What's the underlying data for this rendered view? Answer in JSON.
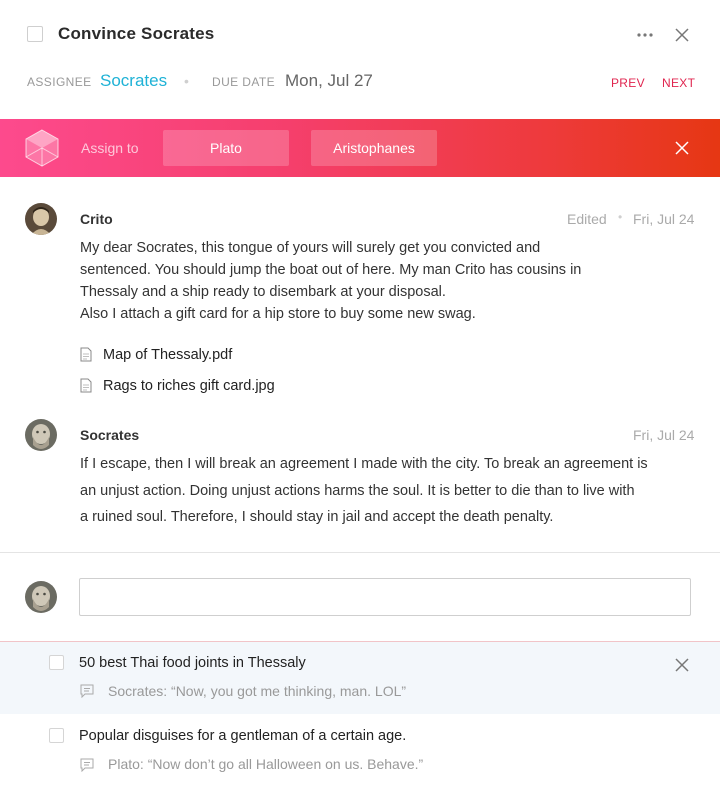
{
  "task": {
    "title": "Convince Socrates",
    "assignee_label": "ASSIGNEE",
    "assignee_value": "Socrates",
    "due_label": "DUE DATE",
    "due_value": "Mon, Jul 27",
    "prev_label": "PREV",
    "next_label": "NEXT",
    "more_icon": "more-horizontal-icon",
    "close_icon": "close-icon"
  },
  "assign_bar": {
    "label": "Assign to",
    "options": [
      "Plato",
      "Aristophanes"
    ],
    "logo_icon": "polyhedron-logo-icon",
    "close_icon": "close-icon"
  },
  "comments": [
    {
      "author": "Crito",
      "edited": "Edited",
      "date": "Fri, Jul 24",
      "lines": [
        "My dear Socrates, this tongue of yours will surely get you convicted and",
        "sentenced. You should jump the boat out of here. My man Crito has cousins in",
        "Thessaly and a ship ready to disembark at your disposal.",
        "Also I attach a gift card for a hip store to buy some new swag."
      ],
      "attachments": [
        "Map of Thessaly.pdf",
        "Rags to riches gift card.jpg"
      ]
    },
    {
      "author": "Socrates",
      "date": "Fri, Jul 24",
      "lines": [
        "If I escape, then I will break an agreement I made with the city. To break an agreement is",
        "an unjust action. Doing unjust actions harms the soul. It is better to die than to live with",
        "a ruined soul. Therefore, I should stay in jail and accept the death penalty."
      ]
    }
  ],
  "new_comment": {
    "value": "",
    "placeholder": ""
  },
  "subtasks": [
    {
      "title": "50 best Thai food joints in Thessaly",
      "comment": "Socrates: “Now, you got me thinking, man. LOL”"
    },
    {
      "title": "Popular disguises for a gentleman of a certain age.",
      "comment": "Plato: “Now don’t go all Halloween on us. Behave.”"
    }
  ],
  "colors": {
    "accent_blue": "#1fb2d6",
    "accent_red": "#e0254f",
    "banner_start": "#fd4a8d",
    "banner_end": "#e63713"
  }
}
